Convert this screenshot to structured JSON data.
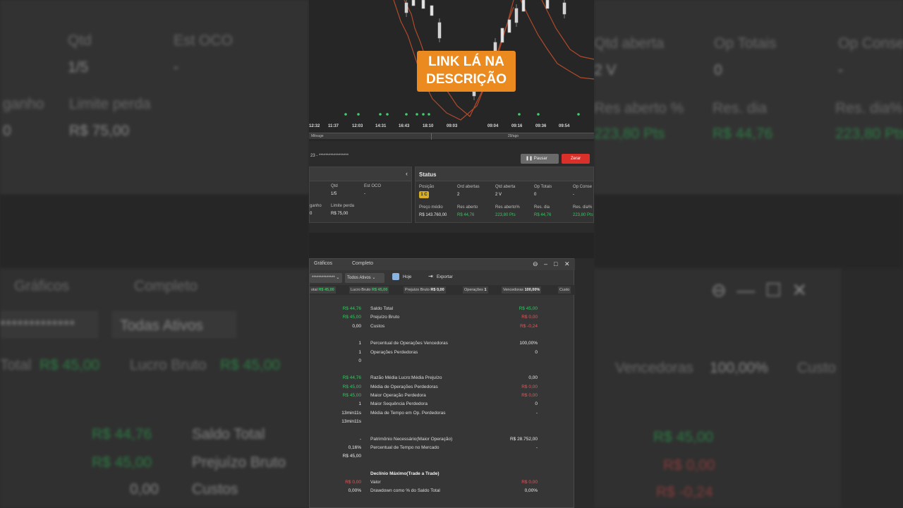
{
  "banner": {
    "line1": "LINK LÁ NA",
    "line2": "DESCRIÇÃO"
  },
  "chart": {
    "time_labels": [
      "12:32",
      "11:37",
      "12:03",
      "14:31",
      "16:43",
      "18:10",
      "09:03",
      "09:04",
      "09:16",
      "09:36",
      "09:54"
    ],
    "scroll_labels": [
      "Mileage",
      "29/ago"
    ]
  },
  "order": {
    "title": "23 - ******************",
    "pause_label": "Pausar",
    "zero_label": "Zerar"
  },
  "left_panel": {
    "qtd_label": "Qtd",
    "qtd_value": "1/5",
    "est_label": "Est OCO",
    "est_value": "-",
    "ganho_label": "ganho",
    "ganho_value": "0",
    "perda_label": "Limite perda",
    "perda_value": "R$ 75,00"
  },
  "status": {
    "title": "Status",
    "posicao_label": "Posição",
    "posicao_value": "1 C",
    "ord_label": "Ord abertas",
    "ord_value": "2",
    "qtd_label": "Qtd aberta",
    "qtd_value": "2 V",
    "optot_label": "Op Totais",
    "optot_value": "0",
    "opcon_label": "Op Conse",
    "opcon_value": "-",
    "preco_label": "Preço médio",
    "preco_value": "R$ 143.760,00",
    "resab_label": "Res aberto",
    "resab_value": "R$ 44,76",
    "respct_label": "Res aberto%",
    "respct_value": "223,80 Pts",
    "resdia_label": "Res. dia",
    "resdia_value": "R$ 44,76",
    "resdiap_label": "Res. dia%",
    "resdiap_value": "223,80 Pts"
  },
  "report": {
    "tabs": [
      "Gráficos",
      "Completo"
    ],
    "account_dd": "**************",
    "assets_dd": "Todos Ativos",
    "today_label": "Hoje",
    "export_label": "Exportar",
    "summary": [
      {
        "label": "otal",
        "value": "R$ 45,00",
        "cls": "g"
      },
      {
        "label": "Lucro Bruto",
        "value": "R$ 45,00",
        "cls": "g"
      },
      {
        "label": "Prejuízo Bruto",
        "value": "R$ 0,00",
        "cls": "w"
      },
      {
        "label": "Operações",
        "value": "1",
        "cls": "w"
      },
      {
        "label": "Vencedoras",
        "value": "100,00%",
        "cls": "w"
      },
      {
        "label": "Custo",
        "value": "",
        "cls": "w"
      }
    ],
    "rows": [
      {
        "lv": "R$ 44,76",
        "lvc": "g",
        "lb": "Saldo Total",
        "rv": "R$ 45,00",
        "rvc": "g",
        "bold": false
      },
      {
        "lv": "R$ 45,00",
        "lvc": "g",
        "lb": "Prejuízo Bruto",
        "rv": "R$ 0,00",
        "rvc": "r",
        "bold": false
      },
      {
        "lv": "0,00",
        "lvc": "w",
        "lb": "Custos",
        "rv": "R$ -0,24",
        "rvc": "r",
        "bold": false
      },
      {
        "lv": "",
        "lvc": "w",
        "lb": "",
        "rv": "",
        "rvc": "w",
        "bold": false
      },
      {
        "lv": "1",
        "lvc": "w",
        "lb": "Percentual de Operações Vencedoras",
        "rv": "100,00%",
        "rvc": "w",
        "bold": false
      },
      {
        "lv": "1",
        "lvc": "w",
        "lb": "Operações Perdedoras",
        "rv": "0",
        "rvc": "w",
        "bold": false
      },
      {
        "lv": "0",
        "lvc": "w",
        "lb": "",
        "rv": "",
        "rvc": "w",
        "bold": false
      },
      {
        "lv": "",
        "lvc": "w",
        "lb": "",
        "rv": "",
        "rvc": "w",
        "bold": false
      },
      {
        "lv": "R$ 44,76",
        "lvc": "g",
        "lb": "Razão Média Lucro:Média Prejuízo",
        "rv": "0,00",
        "rvc": "w",
        "bold": false
      },
      {
        "lv": "R$ 45,00",
        "lvc": "g",
        "lb": "Média de Operações Perdedoras",
        "rv": "R$ 0,00",
        "rvc": "r",
        "bold": false
      },
      {
        "lv": "R$ 45,00",
        "lvc": "g",
        "lb": "Maior Operação Perdedora",
        "rv": "R$ 0,00",
        "rvc": "r",
        "bold": false
      },
      {
        "lv": "1",
        "lvc": "w",
        "lb": "Maior Sequência Perdedora",
        "rv": "0",
        "rvc": "w",
        "bold": false
      },
      {
        "lv": "13min11s",
        "lvc": "w",
        "lb": "Média de Tempo em Op. Perdedoras",
        "rv": "-",
        "rvc": "w",
        "bold": false
      },
      {
        "lv": "13min11s",
        "lvc": "w",
        "lb": "",
        "rv": "",
        "rvc": "w",
        "bold": false
      },
      {
        "lv": "",
        "lvc": "w",
        "lb": "",
        "rv": "",
        "rvc": "w",
        "bold": false
      },
      {
        "lv": "-",
        "lvc": "w",
        "lb": "Patrimônio Necessário(Maior Operação)",
        "rv": "R$ 28.752,00",
        "rvc": "w",
        "bold": false
      },
      {
        "lv": "0,16%",
        "lvc": "w",
        "lb": "Percentual de Tempo no Mercado",
        "rv": "-",
        "rvc": "w",
        "bold": false
      },
      {
        "lv": "R$ 45,00",
        "lvc": "w",
        "lb": "",
        "rv": "",
        "rvc": "w",
        "bold": false
      },
      {
        "lv": "",
        "lvc": "w",
        "lb": "",
        "rv": "",
        "rvc": "w",
        "bold": false
      },
      {
        "lv": "",
        "lvc": "w",
        "lb": "Declínio Máximo(Trade a Trade)",
        "rv": "",
        "rvc": "w",
        "bold": true
      },
      {
        "lv": "R$ 0,00",
        "lvc": "r",
        "lb": "Valor",
        "rv": "R$ 0,00",
        "rvc": "r",
        "bold": false
      },
      {
        "lv": "0,00%",
        "lvc": "w",
        "lb": "Drawdown como % do Saldo Total",
        "rv": "0,00%",
        "rvc": "w",
        "bold": false
      }
    ]
  },
  "side_left": {
    "qtd_label": "Qtd",
    "qtd_value": "1/5",
    "est_label": "Est OCO",
    "est_value": "-",
    "ganho_label": "ganho",
    "ganho_value": "0",
    "perda_label": "Limite perda",
    "perda_value": "R$ 75,00",
    "tab1": "Gráficos",
    "tab2": "Completo",
    "dd1": "*************",
    "dd2": "Todas Ativos",
    "total_label": "Total",
    "total_value": "R$ 45,00",
    "lucro_label": "Lucro Bruto",
    "lucro_value": "R$ 45,00",
    "r1v": "R$ 44,76",
    "r1l": "Saldo Total",
    "r2v": "R$ 45,00",
    "r2l": "Prejuízo Bruto",
    "r3v": "0,00",
    "r3l": "Custos"
  },
  "side_right": {
    "qtd_label": "Qtd aberta",
    "qtd_value": "2 V",
    "op_label": "Op Totais",
    "op_value": "0",
    "con_label": "Op Conse",
    "con_value": "-",
    "resab_label": "Res aberto %",
    "resab_value": "223,80 Pts",
    "resdia_label": "Res. dia",
    "resdia_value": "R$ 44,76",
    "resdiap_label": "Res. dia%",
    "resdiap_value": "223,80 Pts",
    "venc_label": "Vencedoras",
    "venc_value": "100,00%",
    "custo_label": "Custo",
    "r1": "R$ 45,00",
    "r2": "R$ 0,00",
    "r3": "R$ -0,24"
  }
}
